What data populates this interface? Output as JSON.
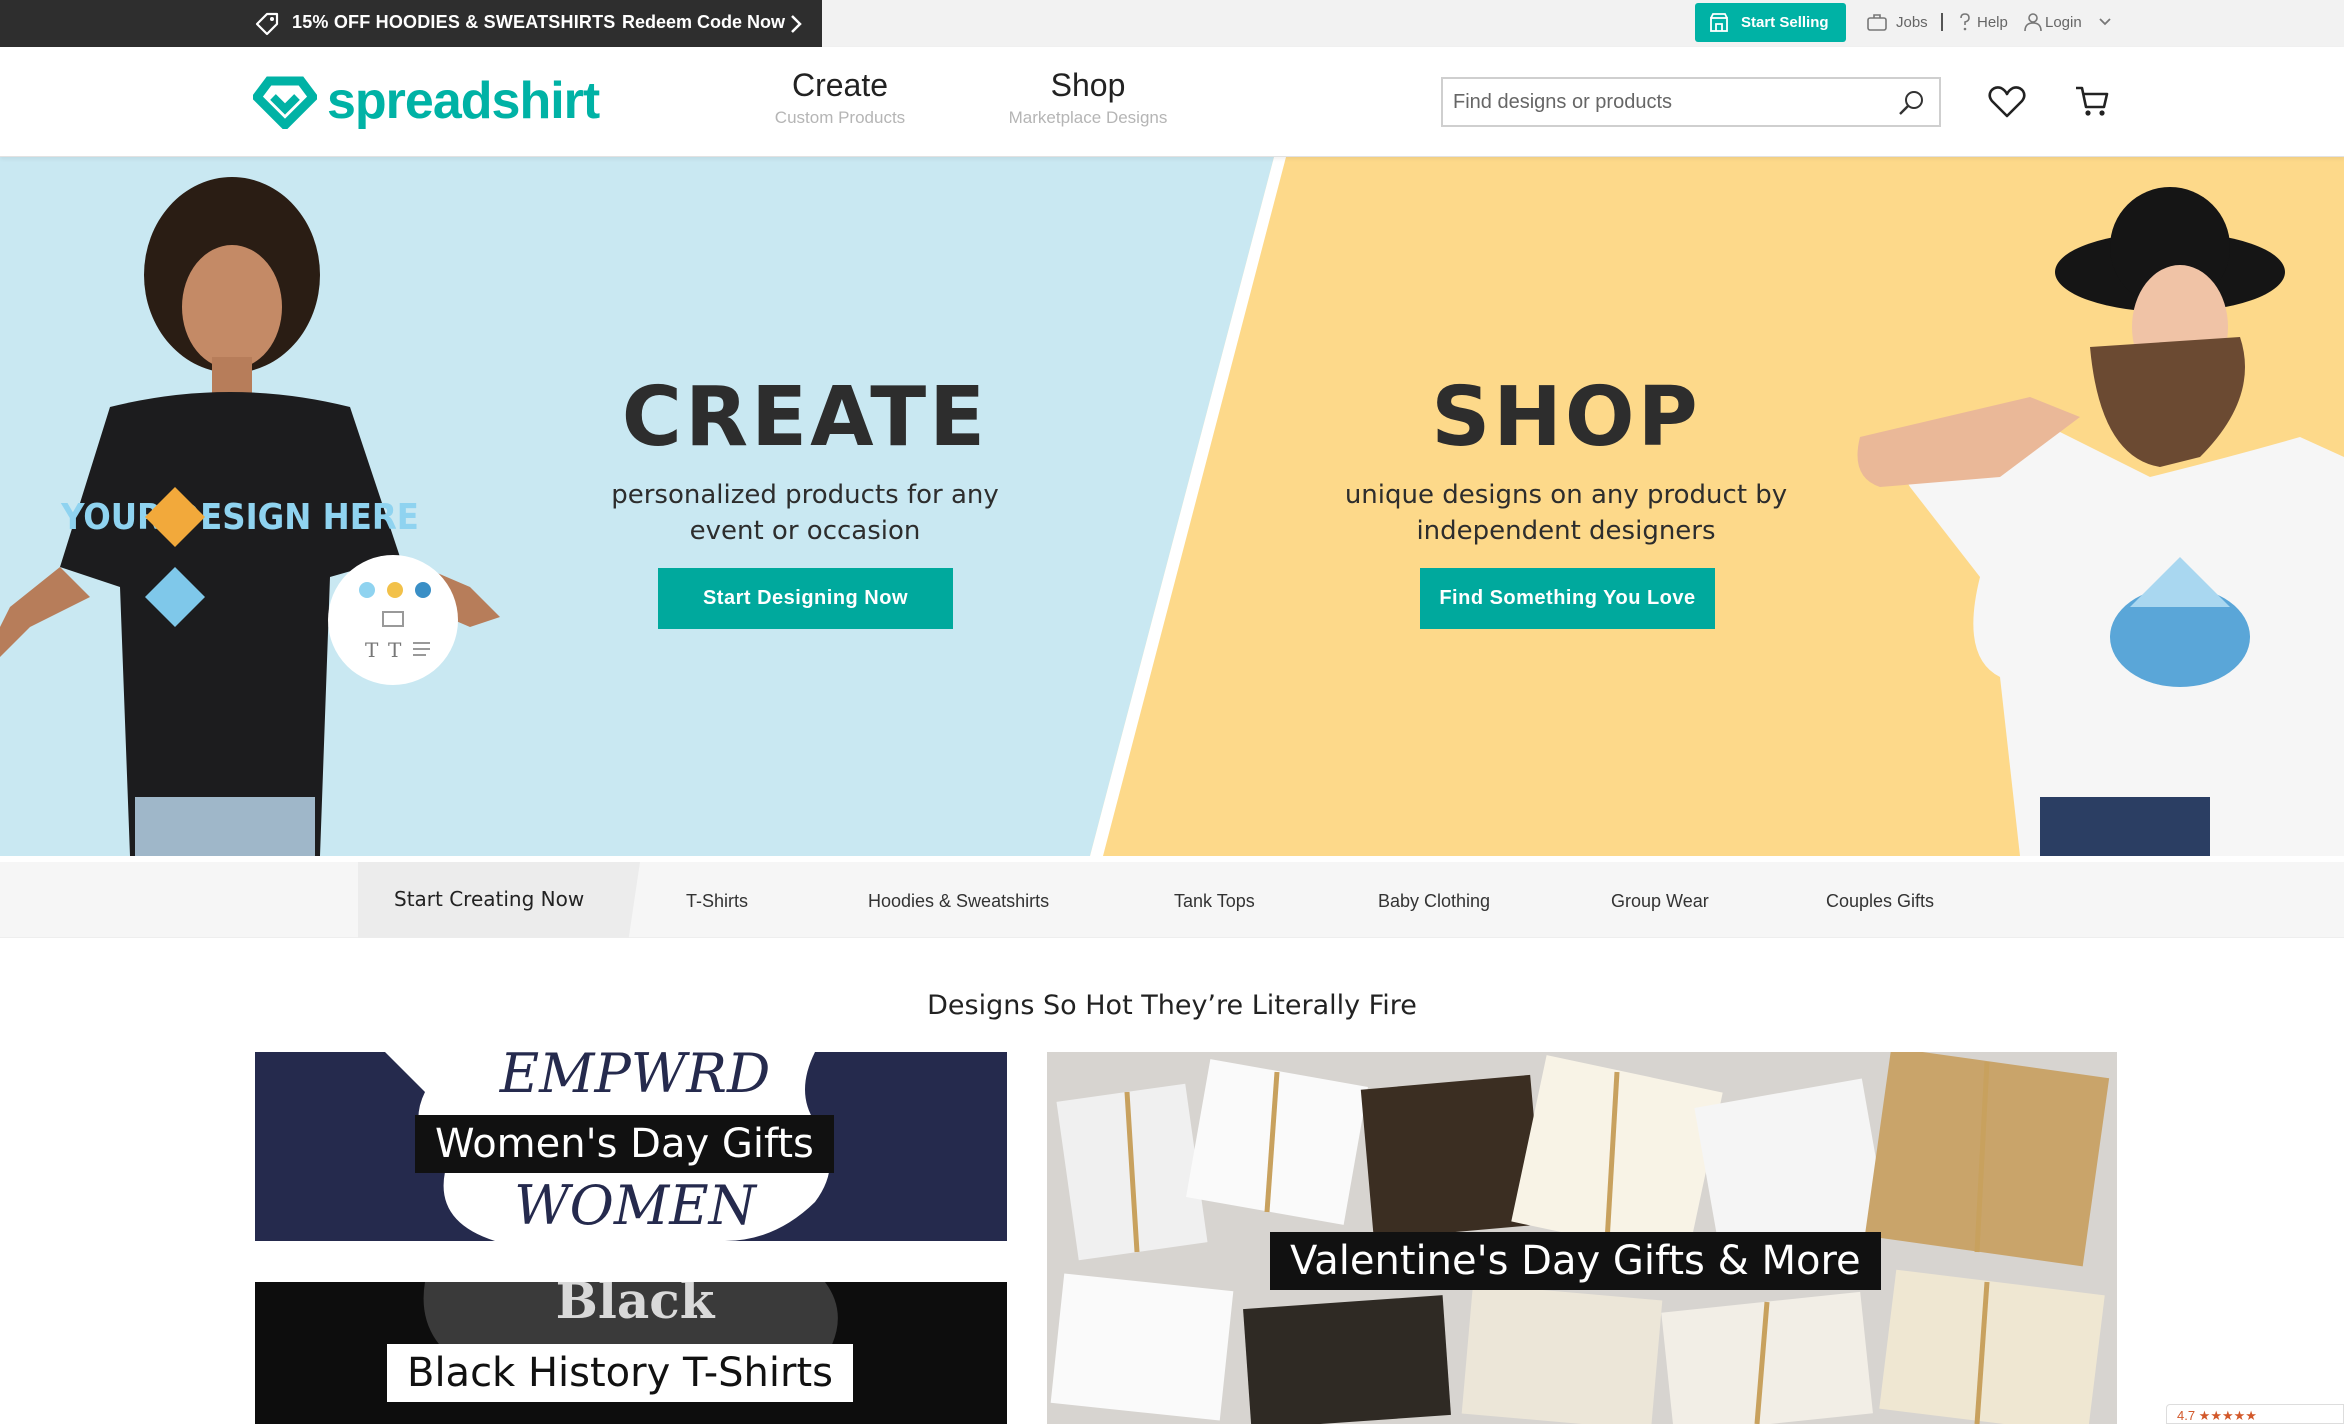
{
  "topbar": {
    "promo_text": "15% OFF HOODIES & SWEATSHIRTS",
    "redeem_label": "Redeem Code Now",
    "start_selling_label": "Start Selling",
    "jobs_label": "Jobs",
    "help_label": "Help",
    "login_label": "Login"
  },
  "header": {
    "logo_text": "spreadshirt",
    "nav": [
      {
        "title": "Create",
        "subtitle": "Custom Products"
      },
      {
        "title": "Shop",
        "subtitle": "Marketplace Designs"
      }
    ],
    "search_placeholder": "Find designs or products"
  },
  "hero": {
    "create": {
      "heading": "CREATE",
      "line1": "personalized products for any",
      "line2": "event or occasion",
      "button": "Start Designing Now",
      "shirt_text": "YOUR DESIGN HERE"
    },
    "shop": {
      "heading": "SHOP",
      "line1": "unique designs on any product by",
      "line2": "independent designers",
      "button": "Find Something You Love"
    }
  },
  "categories": {
    "primary": "Start Creating Now",
    "items": [
      "T-Shirts",
      "Hoodies & Sweatshirts",
      "Tank Tops",
      "Baby Clothing",
      "Group Wear",
      "Couples Gifts"
    ]
  },
  "promos": {
    "title": "Designs So Hot They’re Literally Fire",
    "tiles": [
      {
        "label": "Women's Day Gifts"
      },
      {
        "label": "Black History T-Shirts"
      },
      {
        "label": "Valentine's Day Gifts & More"
      }
    ]
  },
  "rating_badge": "4.7 ★★★★★",
  "colors": {
    "brand": "#00b2a5",
    "create_bg": "#c9e8f2",
    "shop_bg": "#fdd98a",
    "promo_bar": "#2e2e2e"
  }
}
